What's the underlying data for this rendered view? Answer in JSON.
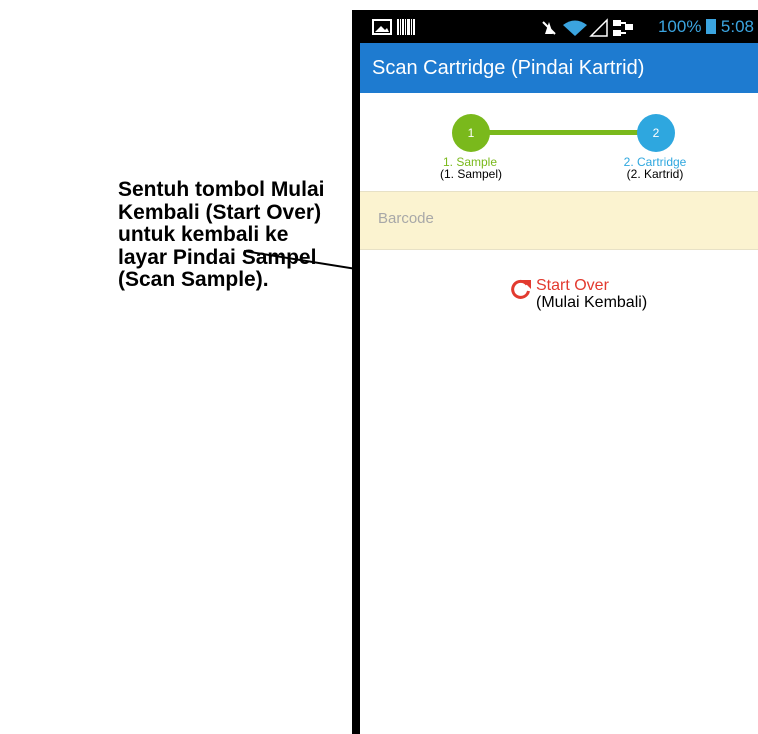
{
  "annotation": {
    "lines": [
      "Sentuh tombol Mulai",
      "Kembali (Start Over)",
      "untuk kembali ke",
      "layar Pindai Sampel",
      "(Scan Sample)."
    ]
  },
  "status_bar": {
    "battery": "100%",
    "time": "5:08"
  },
  "app_bar": {
    "title": "Scan Cartridge",
    "title_translation": "(Pindai Kartrid)",
    "color": "#1e7bd0"
  },
  "stepper": {
    "steps": [
      {
        "number": "1",
        "label": "1. Sample",
        "translation": "(1. Sampel)",
        "color": "#7ab91c"
      },
      {
        "number": "2",
        "label": "2. Cartridge",
        "translation": "(2. Kartrid)",
        "color": "#2ea7df"
      }
    ]
  },
  "barcode": {
    "placeholder": "Barcode",
    "value": ""
  },
  "start_over": {
    "label": "Start Over",
    "translation": "(Mulai Kembali)",
    "icon": "refresh-icon",
    "color": "#e23a2f"
  }
}
